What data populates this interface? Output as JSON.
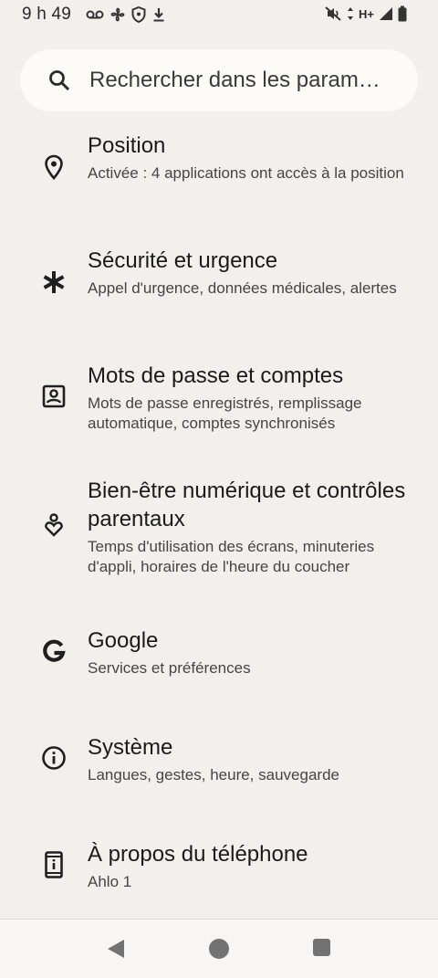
{
  "status_bar": {
    "time": "9 h 49",
    "network": "H+",
    "left_icons": [
      "voicemail-icon",
      "fan-icon",
      "shield-icon",
      "download-icon"
    ],
    "right_icons": [
      "mute-icon",
      "network-arrows-icon",
      "signal-icon",
      "battery-icon"
    ]
  },
  "search": {
    "placeholder": "Rechercher dans les param…"
  },
  "items": [
    {
      "title": "Position",
      "subtitle": "Activée : 4 applications ont accès à la position",
      "icon": "location-pin-icon"
    },
    {
      "title": "Sécurité et urgence",
      "subtitle": "Appel d'urgence, données médicales, alertes",
      "icon": "asterisk-icon"
    },
    {
      "title": "Mots de passe et comptes",
      "subtitle": "Mots de passe enregistrés, remplissage automatique, comptes synchronisés",
      "icon": "account-box-icon"
    },
    {
      "title": "Bien-être numérique et contrôles parentaux",
      "subtitle": "Temps d'utilisation des écrans, minuteries d'appli, horaires de l'heure du coucher",
      "icon": "wellbeing-icon"
    },
    {
      "title": "Google",
      "subtitle": "Services et préférences",
      "icon": "google-icon"
    },
    {
      "title": "Système",
      "subtitle": "Langues, gestes, heure, sauvegarde",
      "icon": "info-icon"
    },
    {
      "title": "À propos du téléphone",
      "subtitle": "Ahlo 1",
      "icon": "phone-info-icon"
    }
  ],
  "nav": {
    "buttons": [
      "back",
      "home",
      "recents"
    ]
  }
}
